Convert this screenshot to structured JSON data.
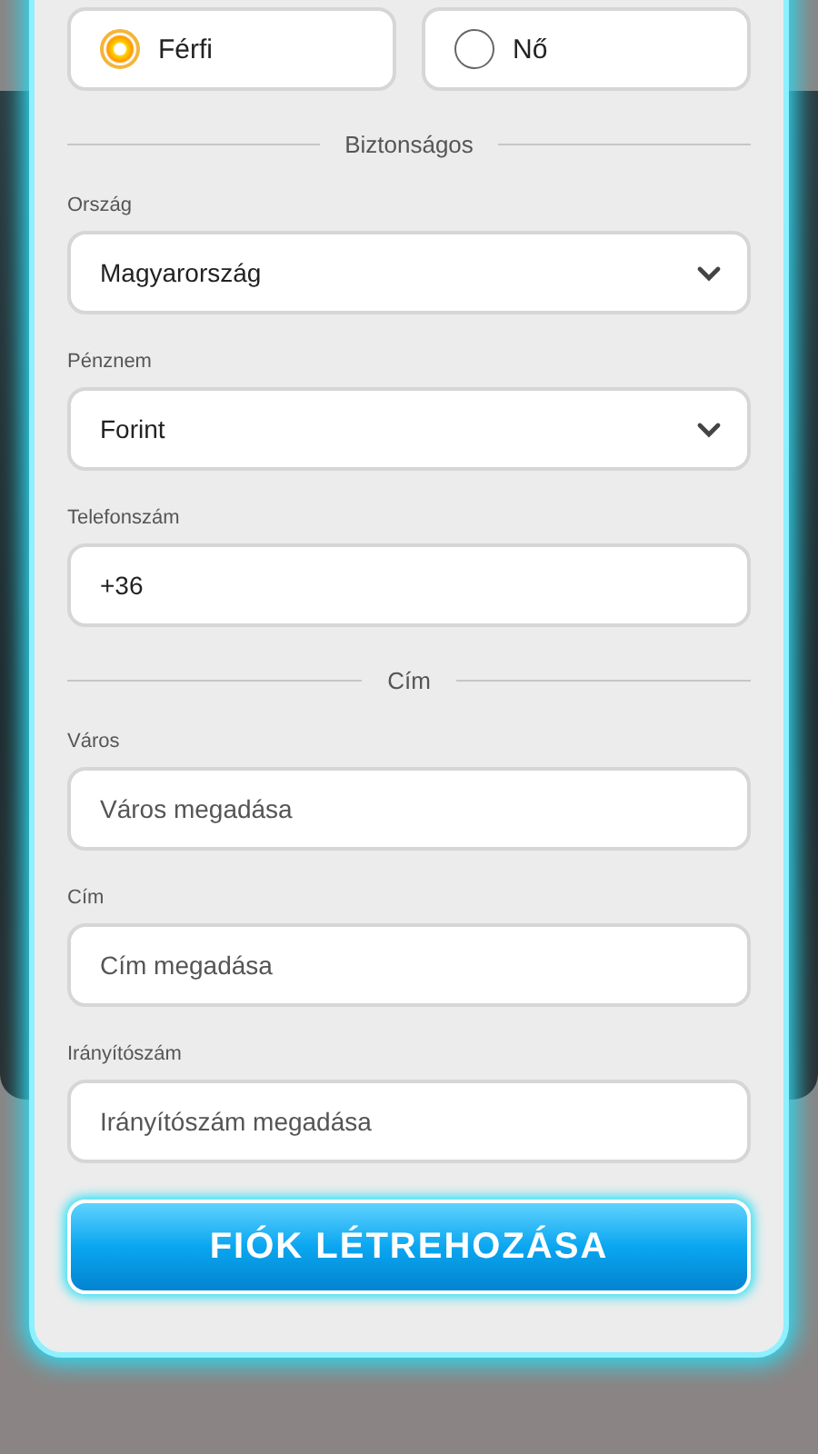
{
  "gender": [
    {
      "label": "Férfi",
      "selected": true
    },
    {
      "label": "Nő",
      "selected": false
    }
  ],
  "form": [
    {
      "kind": "divider",
      "title": "Biztonságos"
    },
    {
      "kind": "select",
      "label": "Ország",
      "value": "Magyarország"
    },
    {
      "kind": "select",
      "label": "Pénznem",
      "value": "Forint"
    },
    {
      "kind": "input",
      "label": "Telefonszám",
      "value": "+36"
    },
    {
      "kind": "divider",
      "title": "Cím"
    },
    {
      "kind": "input",
      "label": "Város",
      "placeholder": "Város megadása"
    },
    {
      "kind": "input",
      "label": "Cím",
      "placeholder": "Cím megadása"
    },
    {
      "kind": "input",
      "label": "Irányítószám",
      "placeholder": "Irányítószám megadása"
    }
  ],
  "submit_button": "FIÓK LÉTREHOZÁSA"
}
